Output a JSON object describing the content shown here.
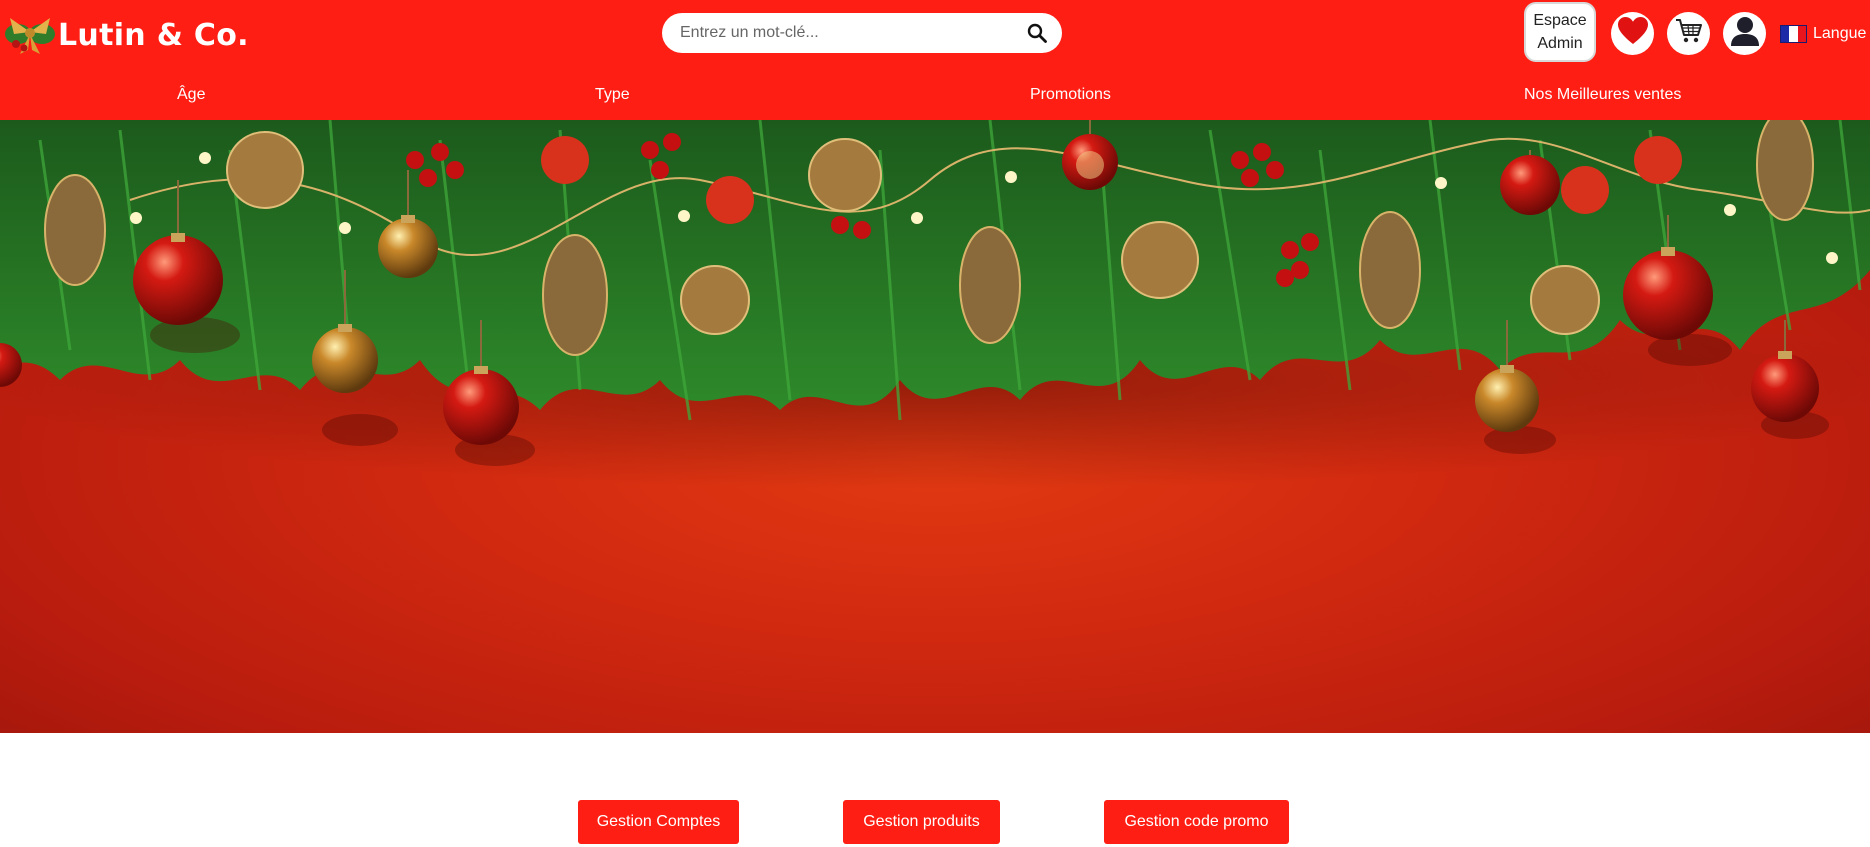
{
  "brand": {
    "name": "Lutin & Co."
  },
  "search": {
    "placeholder": "Entrez un mot-clé...",
    "value": ""
  },
  "header_actions": {
    "admin_line1": "Espace",
    "admin_line2": "Admin",
    "favorites_icon": "heart-icon",
    "cart_icon": "cart-icon",
    "account_icon": "user-icon",
    "language_label": "Langue",
    "language_flag": "flag-fr"
  },
  "nav": {
    "items": [
      {
        "label": "Âge"
      },
      {
        "label": "Type"
      },
      {
        "label": "Promotions"
      },
      {
        "label": "Nos Meilleures ventes"
      }
    ]
  },
  "admin_actions": {
    "accounts_label": "Gestion Comptes",
    "products_label": "Gestion produits",
    "promo_label": "Gestion code promo"
  },
  "colors": {
    "brand_red": "#ff1e14",
    "hero_red": "#d22a10",
    "white": "#ffffff"
  }
}
